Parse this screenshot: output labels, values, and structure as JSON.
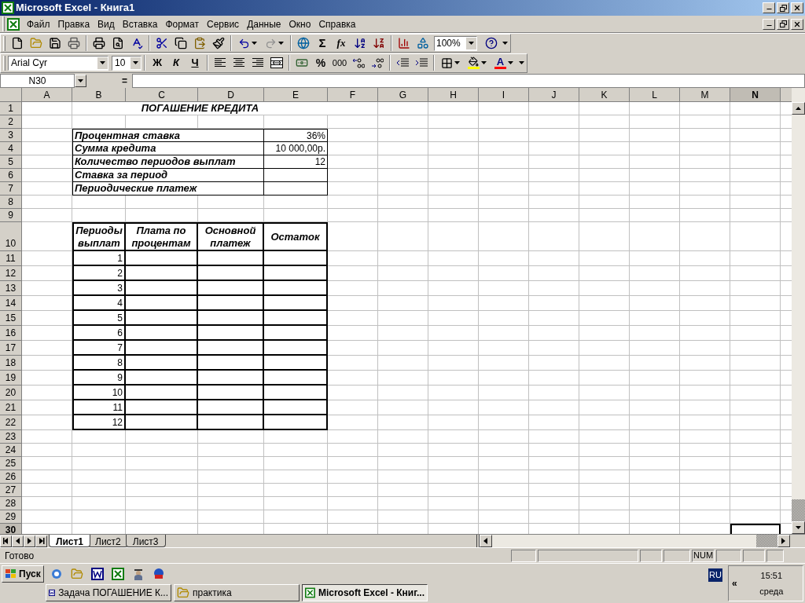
{
  "window": {
    "title": "Microsoft Excel - Книга1"
  },
  "menu": [
    "Файл",
    "Правка",
    "Вид",
    "Вставка",
    "Формат",
    "Сервис",
    "Данные",
    "Окно",
    "Справка"
  ],
  "toolbar": {
    "autosum": "Σ",
    "function": "fx",
    "zoom": "100%"
  },
  "format_bar": {
    "font": "Arial Cyr",
    "size": "10",
    "bold": "Ж",
    "italic": "К",
    "underline": "Ч",
    "percent": "%",
    "thousands": "000",
    "font_color_letter": "A"
  },
  "formula_bar": {
    "name_box": "N30",
    "equals": "="
  },
  "sheet": {
    "columns": [
      {
        "label": "A",
        "selected": false
      },
      {
        "label": "B",
        "selected": false
      },
      {
        "label": "C",
        "selected": false
      },
      {
        "label": "D",
        "selected": false
      },
      {
        "label": "E",
        "selected": false
      },
      {
        "label": "F",
        "selected": false
      },
      {
        "label": "G",
        "selected": false
      },
      {
        "label": "H",
        "selected": false
      },
      {
        "label": "I",
        "selected": false
      },
      {
        "label": "J",
        "selected": false
      },
      {
        "label": "K",
        "selected": false
      },
      {
        "label": "L",
        "selected": false
      },
      {
        "label": "M",
        "selected": false
      },
      {
        "label": "N",
        "selected": true
      }
    ],
    "rows": [
      {
        "label": "1",
        "selected": false
      },
      {
        "label": "2",
        "selected": false
      },
      {
        "label": "3",
        "selected": false
      },
      {
        "label": "4",
        "selected": false
      },
      {
        "label": "5",
        "selected": false
      },
      {
        "label": "6",
        "selected": false
      },
      {
        "label": "7",
        "selected": false
      },
      {
        "label": "8",
        "selected": false
      },
      {
        "label": "9",
        "selected": false
      },
      {
        "label": "10",
        "selected": false
      },
      {
        "label": "11",
        "selected": false
      },
      {
        "label": "12",
        "selected": false
      },
      {
        "label": "13",
        "selected": false
      },
      {
        "label": "14",
        "selected": false
      },
      {
        "label": "15",
        "selected": false
      },
      {
        "label": "16",
        "selected": false
      },
      {
        "label": "17",
        "selected": false
      },
      {
        "label": "18",
        "selected": false
      },
      {
        "label": "19",
        "selected": false
      },
      {
        "label": "20",
        "selected": false
      },
      {
        "label": "21",
        "selected": false
      },
      {
        "label": "22",
        "selected": false
      },
      {
        "label": "23",
        "selected": false
      },
      {
        "label": "24",
        "selected": false
      },
      {
        "label": "25",
        "selected": false
      },
      {
        "label": "26",
        "selected": false
      },
      {
        "label": "27",
        "selected": false
      },
      {
        "label": "28",
        "selected": false
      },
      {
        "label": "29",
        "selected": false
      },
      {
        "label": "30",
        "selected": true
      }
    ],
    "title": "ПОГАШЕНИЕ КРЕДИТА",
    "parameters": [
      {
        "label": "Процентная ставка",
        "value": "36%"
      },
      {
        "label": "Сумма кредита",
        "value": "10 000,00р."
      },
      {
        "label": "Количество периодов выплат",
        "value": "12"
      },
      {
        "label": "Ставка за период"
      },
      {
        "label": "Периодические платеж"
      }
    ],
    "table": {
      "columns": [
        "Периоды выплат",
        "Плата по процентам",
        "Основной платеж",
        "Остаток"
      ],
      "rows": [
        {
          "period": "1"
        },
        {
          "period": "2"
        },
        {
          "period": "3"
        },
        {
          "period": "4"
        },
        {
          "period": "5"
        },
        {
          "period": "6"
        },
        {
          "period": "7"
        },
        {
          "period": "8"
        },
        {
          "period": "9"
        },
        {
          "period": "10"
        },
        {
          "period": "11"
        },
        {
          "period": "12"
        }
      ]
    }
  },
  "sheet_tabs": [
    {
      "label": "Лист1",
      "selected": true
    },
    {
      "label": "Лист2",
      "selected": false
    },
    {
      "label": "Лист3",
      "selected": false
    }
  ],
  "status_bar": {
    "text": "Готово",
    "indicators": [
      "NUM"
    ]
  },
  "taskbar": {
    "start": "Пуск",
    "tasks": [
      {
        "label": "Задача  ПОГАШЕНИЕ К...",
        "selected": false
      },
      {
        "label": "практика",
        "selected": false
      },
      {
        "label": "Microsoft Excel - Книг...",
        "selected": true
      }
    ],
    "tray": {
      "language": "RU",
      "expand": "«",
      "time": "15:51",
      "day": "среда"
    }
  }
}
